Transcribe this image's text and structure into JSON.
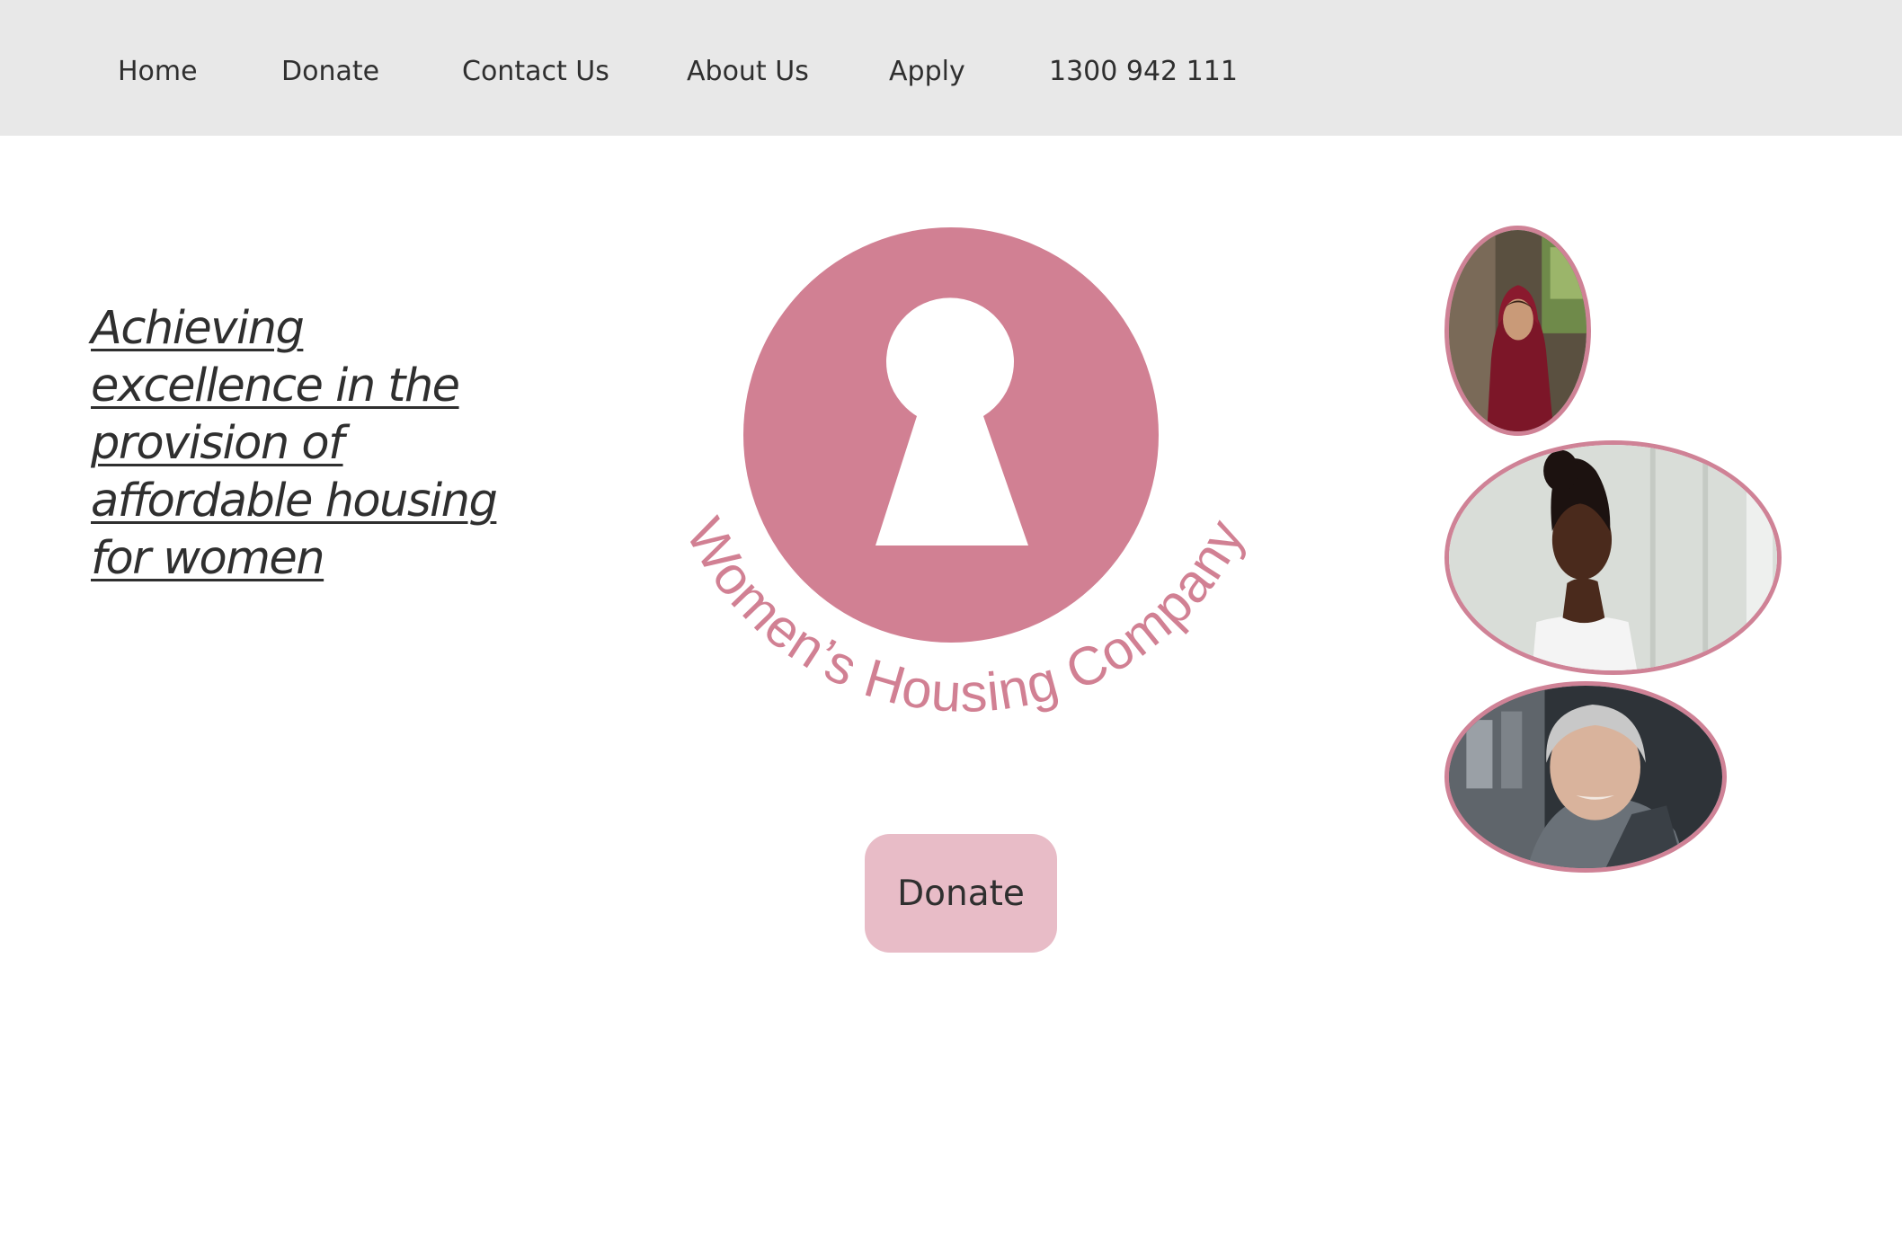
{
  "nav": {
    "items": [
      {
        "label": "Home"
      },
      {
        "label": "Donate"
      },
      {
        "label": "Contact Us"
      },
      {
        "label": "About Us"
      },
      {
        "label": "Apply"
      },
      {
        "label": "1300 942 111"
      }
    ]
  },
  "hero": {
    "tagline": "Achieving excellence in the provision of affordable housing for women",
    "logo_text": "Women’s Housing Company",
    "donate_button": "Donate"
  },
  "photos": [
    {
      "subject": "woman in red headscarf"
    },
    {
      "subject": "woman with braided hair"
    },
    {
      "subject": "smiling older woman"
    }
  ],
  "colors": {
    "nav_background": "#e8e8e8",
    "brand_pink": "#d18093",
    "button_pink": "#e8bcc7",
    "text_dark": "#2f2f2f"
  }
}
